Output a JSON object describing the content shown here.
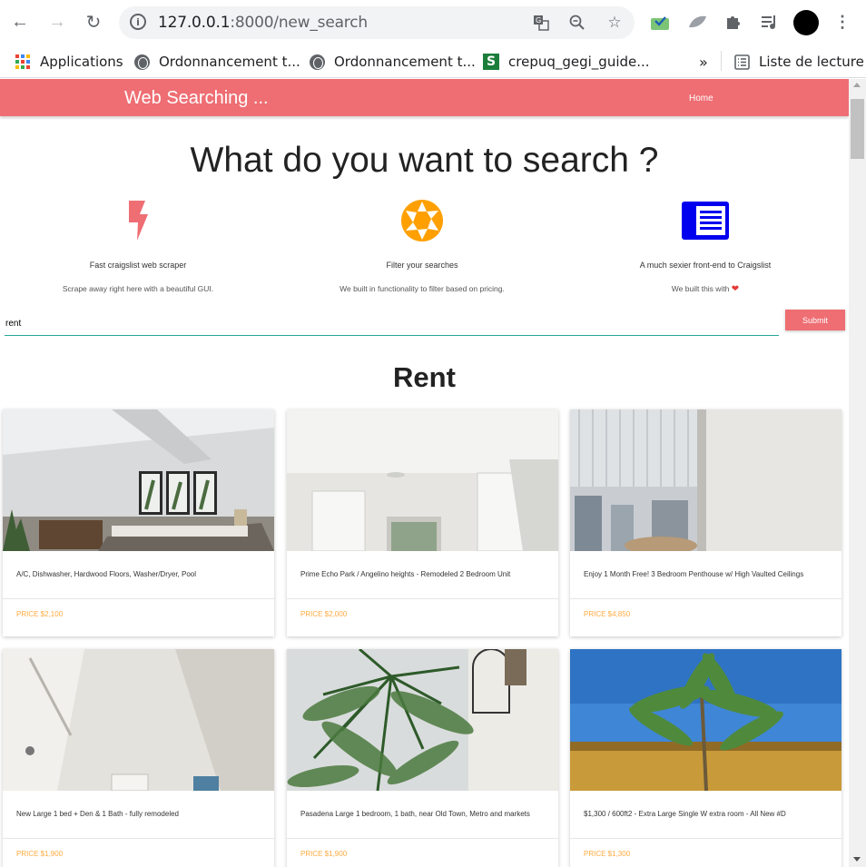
{
  "browser": {
    "url_host": "127.0.0.1",
    "url_path": ":8000/new_search",
    "bookmarks": [
      {
        "label": "Applications",
        "icon": "apps-grid-icon"
      },
      {
        "label": "Ordonnancement t...",
        "icon": "globe-icon"
      },
      {
        "label": "Ordonnancement t...",
        "icon": "globe-icon"
      },
      {
        "label": "crepuq_gegi_guide...",
        "icon": "green-s-icon"
      }
    ],
    "overflow_label": "»",
    "reading_list_label": "Liste de lecture"
  },
  "navbar": {
    "brand": "Web Searching ...",
    "home_link": "Home",
    "color": "#ee6e73"
  },
  "hero": {
    "headline": "What do you want to search ?"
  },
  "features": [
    {
      "icon": "flash-icon",
      "title": "Fast craigslist web scraper",
      "desc": "Scrape away right here with a beautiful GUI."
    },
    {
      "icon": "camera-aperture-icon",
      "title": "Filter your searches",
      "desc": "We built in functionality to filter based on pricing."
    },
    {
      "icon": "article-icon",
      "title": "A much sexier front-end to Craigslist",
      "desc": "We built this with"
    }
  ],
  "search": {
    "value": "rent",
    "submit_label": "Submit"
  },
  "results": {
    "title": "Rent",
    "listings": [
      {
        "title": "A/C, Dishwasher, Hardwood Floors, Washer/Dryer, Pool",
        "price": "PRICE $2,100"
      },
      {
        "title": "Prime Echo Park / Angelino heights - Remodeled 2 Bedroom Unit",
        "price": "PRICE $2,000"
      },
      {
        "title": "Enjoy 1 Month Free! 3 Bedroom Penthouse w/ High Vaulted Ceilings",
        "price": "PRICE $4,850"
      },
      {
        "title": "New Large 1 bed + Den & 1 Bath - fully remodeled",
        "price": "PRICE $1,900"
      },
      {
        "title": "Pasadena Large 1 bedroom, 1 bath, near Old Town, Metro and markets",
        "price": "PRICE $1,900"
      },
      {
        "title": "$1,300 / 600ft2 - Extra Large Single W extra room - All New #D",
        "price": "PRICE $1,300"
      }
    ]
  }
}
